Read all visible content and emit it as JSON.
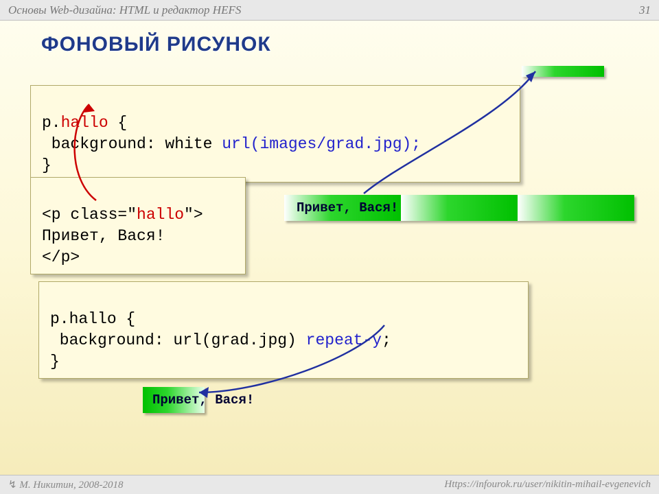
{
  "header": {
    "course_title": "Основы Web-дизайна: HTML и редактор HEFS",
    "page_number": "31"
  },
  "title": "ФОНОВЫЙ РИСУНОК",
  "box1": {
    "l1a": "p.",
    "l1b": "hallo",
    "l1c": " {",
    "l2a": " background: white ",
    "l2b": "url(images/grad.jpg);",
    "l3": "}"
  },
  "box2": {
    "l1a": "<p class=\"",
    "l1b": "hallo",
    "l1c": "\">",
    "l2": "Привет, Вася!",
    "l3": "</p>"
  },
  "box3": {
    "l1": "p.hallo {",
    "l2a": " background: url(grad.jpg) ",
    "l2b": "repeat-y",
    "l2c": ";",
    "l3": "}"
  },
  "output1": "Привет, Вася!",
  "output2": "Привет, Вася!",
  "footer": {
    "author": "М. Никитин, 2008-2018",
    "url": "Https://infourok.ru/user/nikitin-mihail-evgenevich"
  },
  "accessory": "↯"
}
